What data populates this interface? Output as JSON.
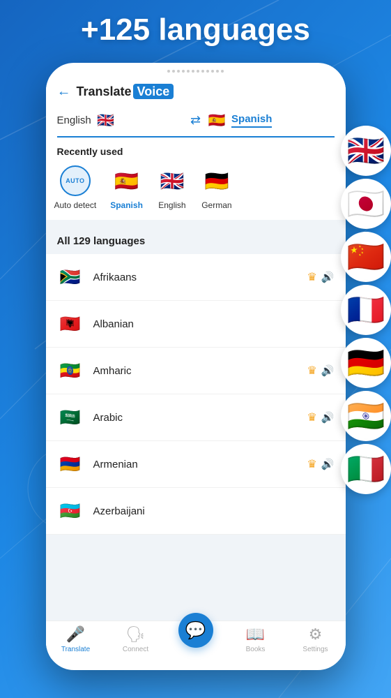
{
  "header": {
    "title": "+125 languages"
  },
  "app": {
    "logo_translate": "Translate",
    "logo_voice": "Voice"
  },
  "language_selector": {
    "from_lang": "English",
    "to_lang": "Spanish",
    "swap_label": "swap languages"
  },
  "recently_used": {
    "title": "Recently used",
    "items": [
      {
        "label": "Auto detect",
        "type": "auto"
      },
      {
        "label": "Spanish",
        "type": "flag",
        "flag": "🇪🇸",
        "highlight": true
      },
      {
        "label": "English",
        "type": "flag",
        "flag": "🇬🇧"
      },
      {
        "label": "German",
        "type": "flag",
        "flag": "🇩🇪"
      }
    ]
  },
  "all_languages": {
    "title": "All 129 languages",
    "items": [
      {
        "name": "Afrikaans",
        "flag": "🇿🇦",
        "has_crown": true,
        "has_speaker": true
      },
      {
        "name": "Albanian",
        "flag": "🇦🇱",
        "has_crown": false,
        "has_speaker": false
      },
      {
        "name": "Amharic",
        "flag": "🇪🇹",
        "has_crown": true,
        "has_speaker": true
      },
      {
        "name": "Arabic",
        "flag": "🇸🇦",
        "has_crown": true,
        "has_speaker": true
      },
      {
        "name": "Armenian",
        "flag": "🇦🇲",
        "has_crown": true,
        "has_speaker": true
      },
      {
        "name": "Azerbaijani",
        "flag": "🇦🇿",
        "has_crown": false,
        "has_speaker": false
      }
    ]
  },
  "floating_flags": [
    "🇬🇧",
    "🇯🇵",
    "🇨🇳",
    "🇫🇷",
    "🇩🇪",
    "🇮🇳",
    "🇮🇹"
  ],
  "bottom_nav": {
    "items": [
      {
        "label": "Translate",
        "active": true,
        "icon": "🎤"
      },
      {
        "label": "Connect",
        "active": false,
        "icon": "🗣"
      },
      {
        "label": "",
        "active": false,
        "icon": "💬",
        "center": true
      },
      {
        "label": "Books",
        "active": false,
        "icon": "📖"
      },
      {
        "label": "Settings",
        "active": false,
        "icon": "⚙"
      }
    ]
  },
  "icons": {
    "back": "←",
    "swap": "⇄",
    "crown": "♛",
    "speaker": "🔊"
  }
}
